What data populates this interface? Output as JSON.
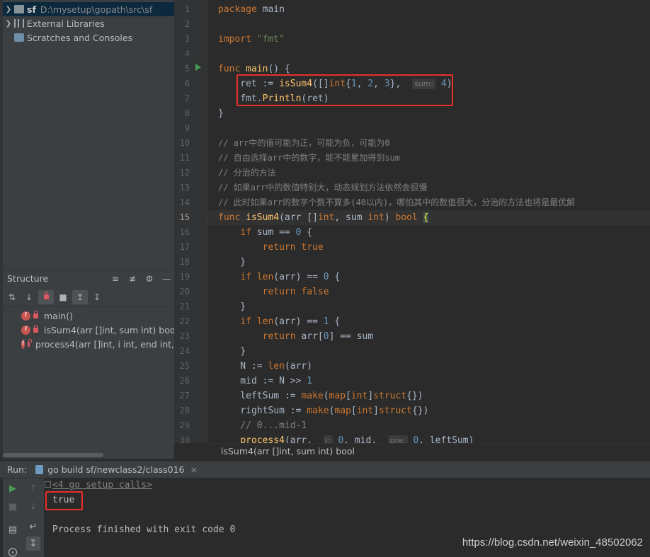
{
  "project_tree": {
    "root_name": "sf",
    "root_path": "D:\\mysetup\\gopath\\src\\sf",
    "items": [
      {
        "label": "External Libraries"
      },
      {
        "label": "Scratches and Consoles"
      }
    ]
  },
  "structure": {
    "title": "Structure",
    "items": [
      {
        "badge": "f",
        "label": "main()"
      },
      {
        "badge": "f",
        "label": "isSum4(arr []int, sum int) bool"
      },
      {
        "badge": "f",
        "label": "process4(arr []int, i int, end int,"
      }
    ]
  },
  "editor": {
    "line_numbers": [
      "1",
      "2",
      "3",
      "4",
      "5",
      "6",
      "7",
      "8",
      "9",
      "10",
      "11",
      "12",
      "13",
      "14",
      "15",
      "16",
      "17",
      "18",
      "19",
      "20",
      "21",
      "22",
      "23",
      "24",
      "25",
      "26",
      "27",
      "28",
      "29",
      "30"
    ],
    "current_line": "15",
    "breadcrumb": "isSum4(arr []int, sum int) bool",
    "hint_sum": "sum:",
    "hint_i": "i:",
    "hint_pre": "pre:",
    "comments": [
      "// arr中的值可能为正，可能为负，可能为0",
      "// 自由选择arr中的数字，能不能累加得到sum",
      "// 分治的方法",
      "// 如果arr中的数值特别大，动态规划方法依然会很慢",
      "// 此时如果arr的数字个数不算多(40以内)，哪怕其中的数值很大，分治的方法也将是最优解"
    ]
  },
  "run": {
    "label": "Run:",
    "config": "go build sf/newclass2/class016",
    "setup_calls": "<4 go setup calls>",
    "output": "true",
    "finish": "Process finished with exit code 0"
  },
  "watermark": "https://blog.csdn.net/weixin_48502062",
  "colors": {
    "highlight_box": "#e8302a",
    "keyword": "#cc7832",
    "function": "#ffc66d",
    "number": "#6897bb",
    "string": "#6a8759"
  }
}
